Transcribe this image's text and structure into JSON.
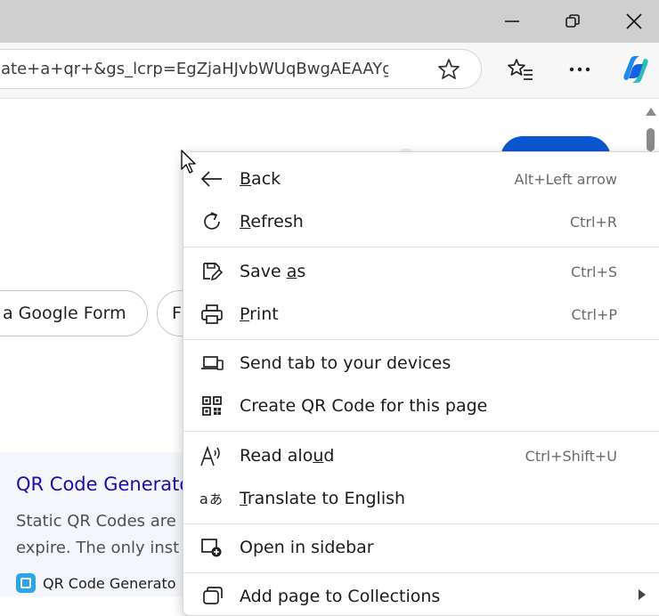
{
  "window": {
    "minimize_icon": "minimize-icon",
    "restore_icon": "restore-icon",
    "close_icon": "close-icon"
  },
  "toolbar": {
    "url": "ate+a+qr+&gs_lcrp=EgZjaHJvbWUqBwgAEAAYg...",
    "favorite_icon": "star-icon",
    "favorites_icon": "favorites-list-icon",
    "more_icon": "more-icon",
    "copilot_icon": "copilot-icon"
  },
  "page": {
    "chips": [
      "a Google Form",
      "F"
    ],
    "result": {
      "title": "QR Code Generato",
      "snippet_lines": [
        "Static QR Codes are",
        "expire. The only inst"
      ],
      "site": "QR Code Generato"
    }
  },
  "context_menu": {
    "items": [
      {
        "label": "Back",
        "accel": "B",
        "rest": "ack",
        "shortcut": "Alt+Left arrow",
        "icon": "back-arrow-icon"
      },
      {
        "label": "Refresh",
        "accel": "R",
        "rest": "efresh",
        "shortcut": "Ctrl+R",
        "icon": "refresh-icon"
      },
      {
        "label": "Save as",
        "pre": "Save ",
        "accel": "a",
        "rest": "s",
        "shortcut": "Ctrl+S",
        "icon": "save-as-icon"
      },
      {
        "label": "Print",
        "accel": "P",
        "rest": "rint",
        "shortcut": "Ctrl+P",
        "icon": "printer-icon"
      },
      {
        "label": "Send tab to your devices",
        "shortcut": "",
        "icon": "send-to-devices-icon"
      },
      {
        "label": "Create QR Code for this page",
        "shortcut": "",
        "icon": "qr-code-icon"
      },
      {
        "label": "Read aloud",
        "pre": "Read alo",
        "accel": "u",
        "rest": "d",
        "shortcut": "Ctrl+Shift+U",
        "icon": "read-aloud-icon"
      },
      {
        "label": "Translate to English",
        "accel": "T",
        "rest": "ranslate to English",
        "shortcut": "",
        "icon": "translate-icon"
      },
      {
        "label": "Open in sidebar",
        "shortcut": "",
        "icon": "open-in-sidebar-icon"
      },
      {
        "label": "Add page to Collections",
        "shortcut": "",
        "icon": "collections-icon"
      }
    ]
  }
}
